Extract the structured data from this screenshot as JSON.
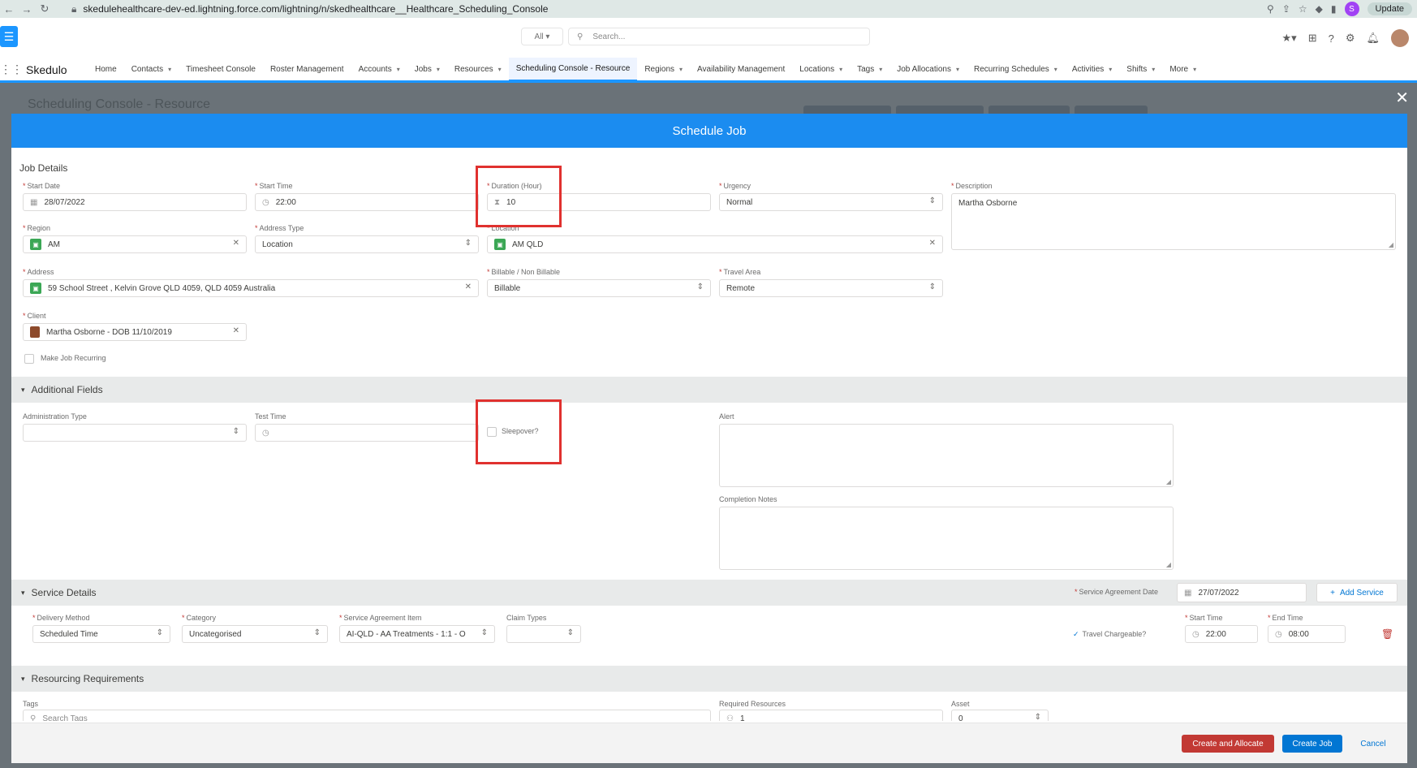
{
  "browser": {
    "url": "skedulehealthcare-dev-ed.lightning.force.com/lightning/n/skedhealthcare__Healthcare_Scheduling_Console",
    "update_label": "Update",
    "profile_initial": "S"
  },
  "header": {
    "search_scope": "All",
    "search_placeholder": "Search..."
  },
  "nav": {
    "app_name": "Skedulo",
    "items": [
      {
        "label": "Home",
        "dropdown": false
      },
      {
        "label": "Contacts",
        "dropdown": true
      },
      {
        "label": "Timesheet Console",
        "dropdown": false
      },
      {
        "label": "Roster Management",
        "dropdown": false
      },
      {
        "label": "Accounts",
        "dropdown": true
      },
      {
        "label": "Jobs",
        "dropdown": true
      },
      {
        "label": "Resources",
        "dropdown": true
      },
      {
        "label": "Scheduling Console - Resource",
        "dropdown": false,
        "active": true
      },
      {
        "label": "Regions",
        "dropdown": true
      },
      {
        "label": "Availability Management",
        "dropdown": false
      },
      {
        "label": "Locations",
        "dropdown": true
      },
      {
        "label": "Tags",
        "dropdown": true
      },
      {
        "label": "Job Allocations",
        "dropdown": true
      },
      {
        "label": "Recurring Schedules",
        "dropdown": true
      },
      {
        "label": "Activities",
        "dropdown": true
      },
      {
        "label": "Shifts",
        "dropdown": true
      },
      {
        "label": "More",
        "dropdown": true
      }
    ]
  },
  "background": {
    "page_title": "Scheduling Console - Resource"
  },
  "modal": {
    "title": "Schedule Job",
    "job_details": {
      "heading": "Job Details",
      "start_date": {
        "label": "Start Date",
        "value": "28/07/2022"
      },
      "start_time": {
        "label": "Start Time",
        "value": "22:00"
      },
      "duration": {
        "label": "Duration (Hour)",
        "value": "10"
      },
      "urgency": {
        "label": "Urgency",
        "value": "Normal"
      },
      "description": {
        "label": "Description",
        "value": "Martha Osborne"
      },
      "region": {
        "label": "Region",
        "value": "AM"
      },
      "address_type": {
        "label": "Address Type",
        "value": "Location"
      },
      "location": {
        "label": "Location",
        "value": "AM QLD"
      },
      "address": {
        "label": "Address",
        "value": "59 School Street , Kelvin Grove QLD 4059, QLD 4059 Australia"
      },
      "billable": {
        "label": "Billable / Non Billable",
        "value": "Billable"
      },
      "travel_area": {
        "label": "Travel Area",
        "value": "Remote"
      },
      "client": {
        "label": "Client",
        "value": "Martha Osborne - DOB 11/10/2019"
      },
      "recurring_label": "Make Job Recurring"
    },
    "additional": {
      "heading": "Additional Fields",
      "admin_type_label": "Administration Type",
      "test_time_label": "Test Time",
      "sleepover_label": "Sleepover?",
      "alert_label": "Alert",
      "completion_notes_label": "Completion Notes"
    },
    "service": {
      "heading": "Service Details",
      "agreement_date_label": "Service Agreement Date",
      "agreement_date_value": "27/07/2022",
      "add_service_label": "Add Service",
      "delivery_method": {
        "label": "Delivery Method",
        "value": "Scheduled Time"
      },
      "category": {
        "label": "Category",
        "value": "Uncategorised"
      },
      "agreement_item": {
        "label": "Service Agreement Item",
        "value": "AI-QLD - AA Treatments - 1:1 - O"
      },
      "claim_types": {
        "label": "Claim Types",
        "value": ""
      },
      "travel_chargeable": "Travel Chargeable?",
      "start_time": {
        "label": "Start Time",
        "value": "22:00"
      },
      "end_time": {
        "label": "End Time",
        "value": "08:00"
      }
    },
    "resourcing": {
      "heading": "Resourcing Requirements",
      "tags_label": "Tags",
      "tags_placeholder": "Search Tags",
      "required_resources": {
        "label": "Required Resources",
        "value": "1"
      },
      "asset": {
        "label": "Asset",
        "value": "0"
      }
    },
    "footer": {
      "create_allocate": "Create and Allocate",
      "create_job": "Create Job",
      "cancel": "Cancel"
    }
  },
  "colors": {
    "brand_blue": "#1b8cf0",
    "highlight_red": "#e0312f",
    "danger": "#c23934"
  }
}
